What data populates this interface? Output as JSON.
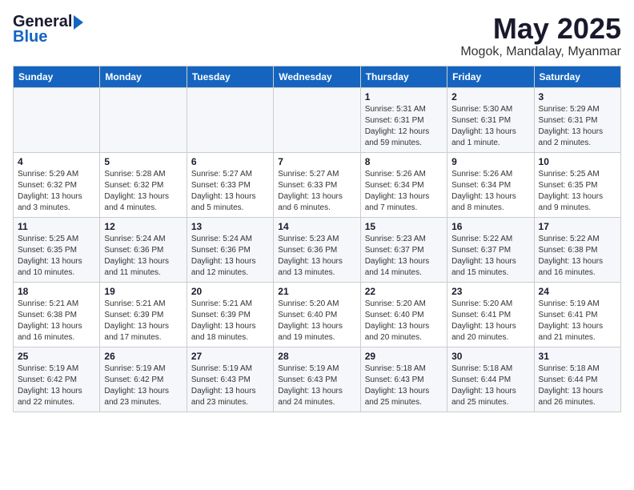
{
  "logo": {
    "general": "General",
    "blue": "Blue"
  },
  "title": "May 2025",
  "location": "Mogok, Mandalay, Myanmar",
  "days_of_week": [
    "Sunday",
    "Monday",
    "Tuesday",
    "Wednesday",
    "Thursday",
    "Friday",
    "Saturday"
  ],
  "weeks": [
    [
      {
        "day": "",
        "info": ""
      },
      {
        "day": "",
        "info": ""
      },
      {
        "day": "",
        "info": ""
      },
      {
        "day": "",
        "info": ""
      },
      {
        "day": "1",
        "info": "Sunrise: 5:31 AM\nSunset: 6:31 PM\nDaylight: 12 hours\nand 59 minutes."
      },
      {
        "day": "2",
        "info": "Sunrise: 5:30 AM\nSunset: 6:31 PM\nDaylight: 13 hours\nand 1 minute."
      },
      {
        "day": "3",
        "info": "Sunrise: 5:29 AM\nSunset: 6:31 PM\nDaylight: 13 hours\nand 2 minutes."
      }
    ],
    [
      {
        "day": "4",
        "info": "Sunrise: 5:29 AM\nSunset: 6:32 PM\nDaylight: 13 hours\nand 3 minutes."
      },
      {
        "day": "5",
        "info": "Sunrise: 5:28 AM\nSunset: 6:32 PM\nDaylight: 13 hours\nand 4 minutes."
      },
      {
        "day": "6",
        "info": "Sunrise: 5:27 AM\nSunset: 6:33 PM\nDaylight: 13 hours\nand 5 minutes."
      },
      {
        "day": "7",
        "info": "Sunrise: 5:27 AM\nSunset: 6:33 PM\nDaylight: 13 hours\nand 6 minutes."
      },
      {
        "day": "8",
        "info": "Sunrise: 5:26 AM\nSunset: 6:34 PM\nDaylight: 13 hours\nand 7 minutes."
      },
      {
        "day": "9",
        "info": "Sunrise: 5:26 AM\nSunset: 6:34 PM\nDaylight: 13 hours\nand 8 minutes."
      },
      {
        "day": "10",
        "info": "Sunrise: 5:25 AM\nSunset: 6:35 PM\nDaylight: 13 hours\nand 9 minutes."
      }
    ],
    [
      {
        "day": "11",
        "info": "Sunrise: 5:25 AM\nSunset: 6:35 PM\nDaylight: 13 hours\nand 10 minutes."
      },
      {
        "day": "12",
        "info": "Sunrise: 5:24 AM\nSunset: 6:36 PM\nDaylight: 13 hours\nand 11 minutes."
      },
      {
        "day": "13",
        "info": "Sunrise: 5:24 AM\nSunset: 6:36 PM\nDaylight: 13 hours\nand 12 minutes."
      },
      {
        "day": "14",
        "info": "Sunrise: 5:23 AM\nSunset: 6:36 PM\nDaylight: 13 hours\nand 13 minutes."
      },
      {
        "day": "15",
        "info": "Sunrise: 5:23 AM\nSunset: 6:37 PM\nDaylight: 13 hours\nand 14 minutes."
      },
      {
        "day": "16",
        "info": "Sunrise: 5:22 AM\nSunset: 6:37 PM\nDaylight: 13 hours\nand 15 minutes."
      },
      {
        "day": "17",
        "info": "Sunrise: 5:22 AM\nSunset: 6:38 PM\nDaylight: 13 hours\nand 16 minutes."
      }
    ],
    [
      {
        "day": "18",
        "info": "Sunrise: 5:21 AM\nSunset: 6:38 PM\nDaylight: 13 hours\nand 16 minutes."
      },
      {
        "day": "19",
        "info": "Sunrise: 5:21 AM\nSunset: 6:39 PM\nDaylight: 13 hours\nand 17 minutes."
      },
      {
        "day": "20",
        "info": "Sunrise: 5:21 AM\nSunset: 6:39 PM\nDaylight: 13 hours\nand 18 minutes."
      },
      {
        "day": "21",
        "info": "Sunrise: 5:20 AM\nSunset: 6:40 PM\nDaylight: 13 hours\nand 19 minutes."
      },
      {
        "day": "22",
        "info": "Sunrise: 5:20 AM\nSunset: 6:40 PM\nDaylight: 13 hours\nand 20 minutes."
      },
      {
        "day": "23",
        "info": "Sunrise: 5:20 AM\nSunset: 6:41 PM\nDaylight: 13 hours\nand 20 minutes."
      },
      {
        "day": "24",
        "info": "Sunrise: 5:19 AM\nSunset: 6:41 PM\nDaylight: 13 hours\nand 21 minutes."
      }
    ],
    [
      {
        "day": "25",
        "info": "Sunrise: 5:19 AM\nSunset: 6:42 PM\nDaylight: 13 hours\nand 22 minutes."
      },
      {
        "day": "26",
        "info": "Sunrise: 5:19 AM\nSunset: 6:42 PM\nDaylight: 13 hours\nand 23 minutes."
      },
      {
        "day": "27",
        "info": "Sunrise: 5:19 AM\nSunset: 6:43 PM\nDaylight: 13 hours\nand 23 minutes."
      },
      {
        "day": "28",
        "info": "Sunrise: 5:19 AM\nSunset: 6:43 PM\nDaylight: 13 hours\nand 24 minutes."
      },
      {
        "day": "29",
        "info": "Sunrise: 5:18 AM\nSunset: 6:43 PM\nDaylight: 13 hours\nand 25 minutes."
      },
      {
        "day": "30",
        "info": "Sunrise: 5:18 AM\nSunset: 6:44 PM\nDaylight: 13 hours\nand 25 minutes."
      },
      {
        "day": "31",
        "info": "Sunrise: 5:18 AM\nSunset: 6:44 PM\nDaylight: 13 hours\nand 26 minutes."
      }
    ]
  ]
}
